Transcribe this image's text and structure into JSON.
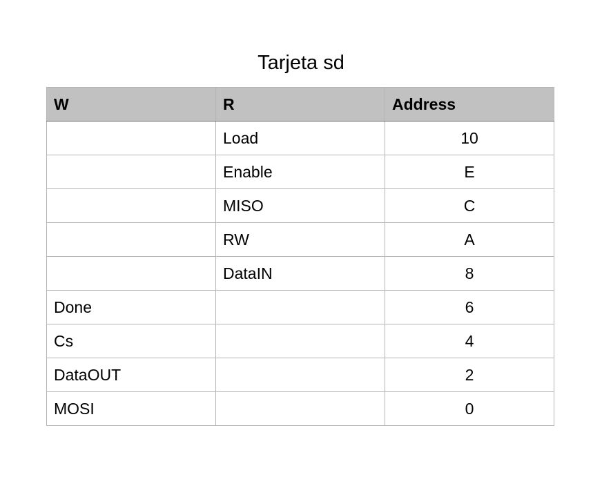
{
  "title": "Tarjeta sd",
  "table": {
    "headers": [
      "W",
      "R",
      "Address"
    ],
    "rows": [
      [
        "",
        "Load",
        "10"
      ],
      [
        "",
        "Enable",
        "E"
      ],
      [
        "",
        "MISO",
        "C"
      ],
      [
        "",
        "RW",
        "A"
      ],
      [
        "",
        "DataIN",
        "8"
      ],
      [
        "Done",
        "",
        "6"
      ],
      [
        "Cs",
        "",
        "4"
      ],
      [
        "DataOUT",
        "",
        "2"
      ],
      [
        "MOSI",
        "",
        "0"
      ]
    ]
  },
  "colors": {
    "header_background": "#c0c1c0",
    "grid_line": "#b4b4b4"
  }
}
